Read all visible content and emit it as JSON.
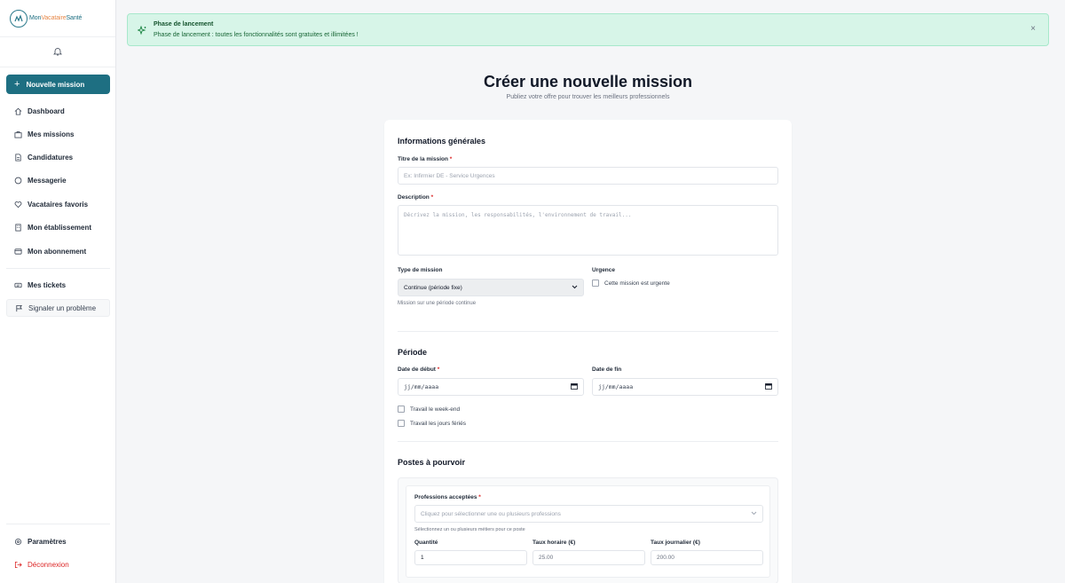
{
  "app": {
    "logo_text_1": "Mon",
    "logo_text_2": "Vacataire",
    "logo_text_3": "Santé"
  },
  "sidebar": {
    "new_mission": "Nouvelle mission",
    "items": [
      {
        "label": "Dashboard",
        "icon": "home-icon"
      },
      {
        "label": "Mes missions",
        "icon": "briefcase-icon"
      },
      {
        "label": "Candidatures",
        "icon": "document-icon"
      },
      {
        "label": "Messagerie",
        "icon": "chat-icon"
      },
      {
        "label": "Vacataires favoris",
        "icon": "heart-icon"
      },
      {
        "label": "Mon établissement",
        "icon": "building-icon"
      },
      {
        "label": "Mon abonnement",
        "icon": "card-icon"
      }
    ],
    "tickets": "Mes tickets",
    "report": "Signaler un problème",
    "settings": "Paramètres",
    "logout": "Déconnexion"
  },
  "banner": {
    "title": "Phase de lancement",
    "text": "Phase de lancement : toutes les fonctionnalités sont gratuites et illimitées !",
    "close": "×"
  },
  "header": {
    "title": "Créer une nouvelle mission",
    "subtitle": "Publiez votre offre pour trouver les meilleurs professionnels"
  },
  "form": {
    "general": {
      "title": "Informations générales",
      "mission_title_label": "Titre de la mission",
      "mission_title_placeholder": "Ex: Infirmier DE - Service Urgences",
      "description_label": "Description",
      "description_placeholder": "Décrivez la mission, les responsabilités, l'environnement de travail...",
      "type_label": "Type de mission",
      "type_value": "Continue (période fixe)",
      "type_help": "Mission sur une période continue",
      "urgency_label": "Urgence",
      "urgency_checkbox": "Cette mission est urgente"
    },
    "period": {
      "title": "Période",
      "start_label": "Date de début",
      "end_label": "Date de fin",
      "date_placeholder": "jj/mm/aaaa",
      "weekend": "Travail le week-end",
      "holidays": "Travail les jours fériés"
    },
    "positions": {
      "title": "Postes à pourvoir",
      "professions_label": "Professions acceptées",
      "professions_placeholder": "Cliquez pour sélectionner une ou plusieurs professions",
      "professions_help": "Sélectionnez un ou plusieurs métiers pour ce poste",
      "quantity_label": "Quantité",
      "quantity_value": "1",
      "hourly_label": "Taux horaire (€)",
      "hourly_value": "25.00",
      "daily_label": "Taux journalier (€)",
      "daily_value": "200.00"
    },
    "required_mark": "*"
  },
  "colors": {
    "primary": "#1e6f82",
    "banner_bg": "#d7f5e8",
    "danger": "#dc2626"
  }
}
